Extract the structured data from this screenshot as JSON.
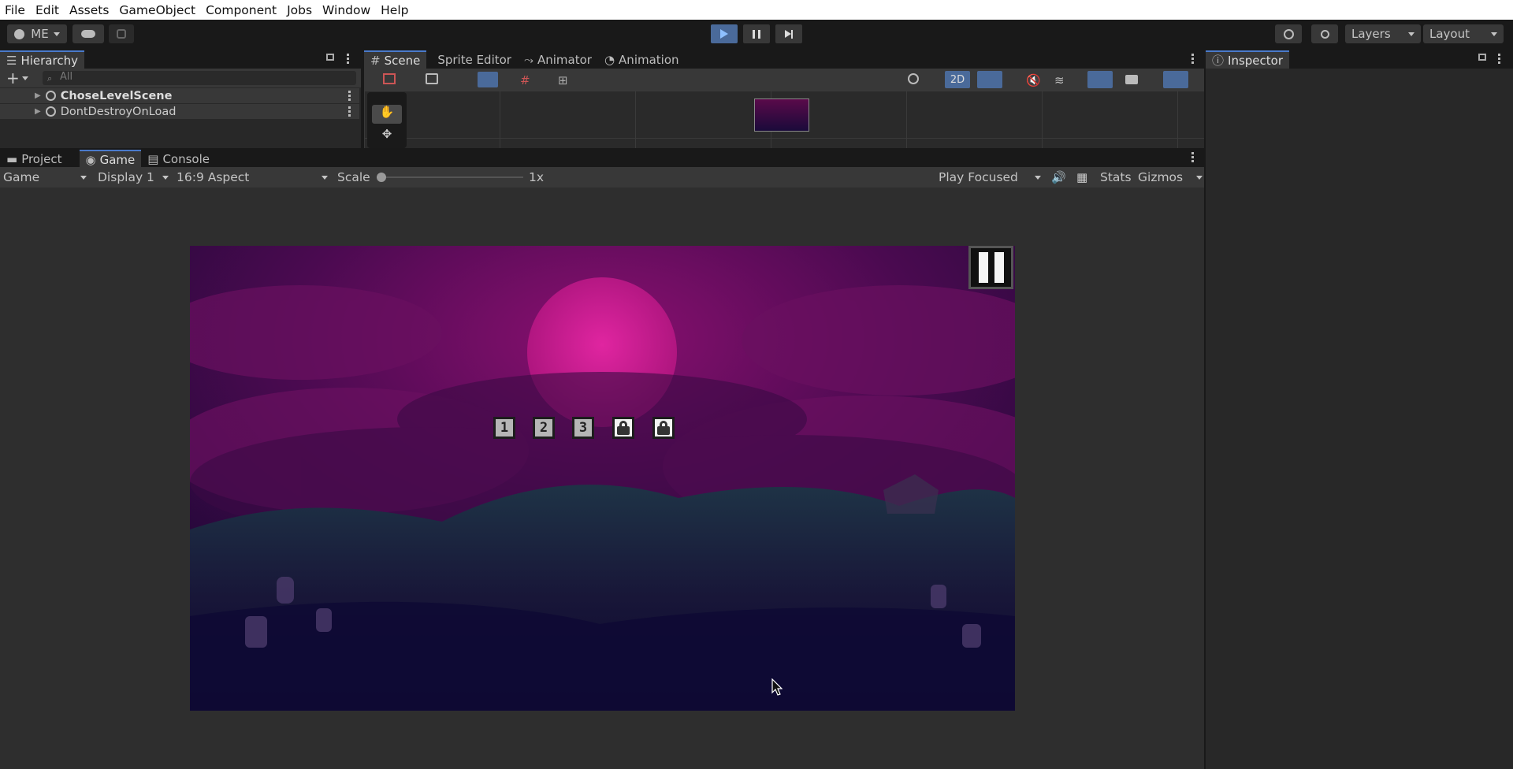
{
  "menu": [
    "File",
    "Edit",
    "Assets",
    "GameObject",
    "Component",
    "Jobs",
    "Window",
    "Help"
  ],
  "toolbar": {
    "account": "ME",
    "layers": "Layers",
    "layout": "Layout"
  },
  "hierarchy": {
    "tab": "Hierarchy",
    "search_placeholder": "All",
    "items": [
      {
        "label": "ChoseLevelScene"
      },
      {
        "label": "DontDestroyOnLoad"
      }
    ]
  },
  "scene_tabs": [
    "Scene",
    "Sprite Editor",
    "Animator",
    "Animation"
  ],
  "scene_toolbar": {
    "mode_2d": "2D"
  },
  "bottom_tabs": [
    "Project",
    "Game",
    "Console"
  ],
  "game_bar": {
    "view": "Game",
    "display": "Display 1",
    "aspect": "16:9 Aspect",
    "scale_label": "Scale",
    "scale_value": "1x",
    "play_mode": "Play Focused",
    "stats": "Stats",
    "gizmos": "Gizmos"
  },
  "game": {
    "levels": [
      {
        "label": "1",
        "locked": false
      },
      {
        "label": "2",
        "locked": false
      },
      {
        "label": "3",
        "locked": false
      },
      {
        "label": "",
        "locked": true
      },
      {
        "label": "",
        "locked": true
      }
    ]
  },
  "inspector": {
    "tab": "Inspector"
  },
  "colors": {
    "accent": "#4a7acb",
    "play_active": "#4a6a9a",
    "moon": "#d0208a",
    "sky": "#6a0a55",
    "ground": "#0c0730"
  }
}
